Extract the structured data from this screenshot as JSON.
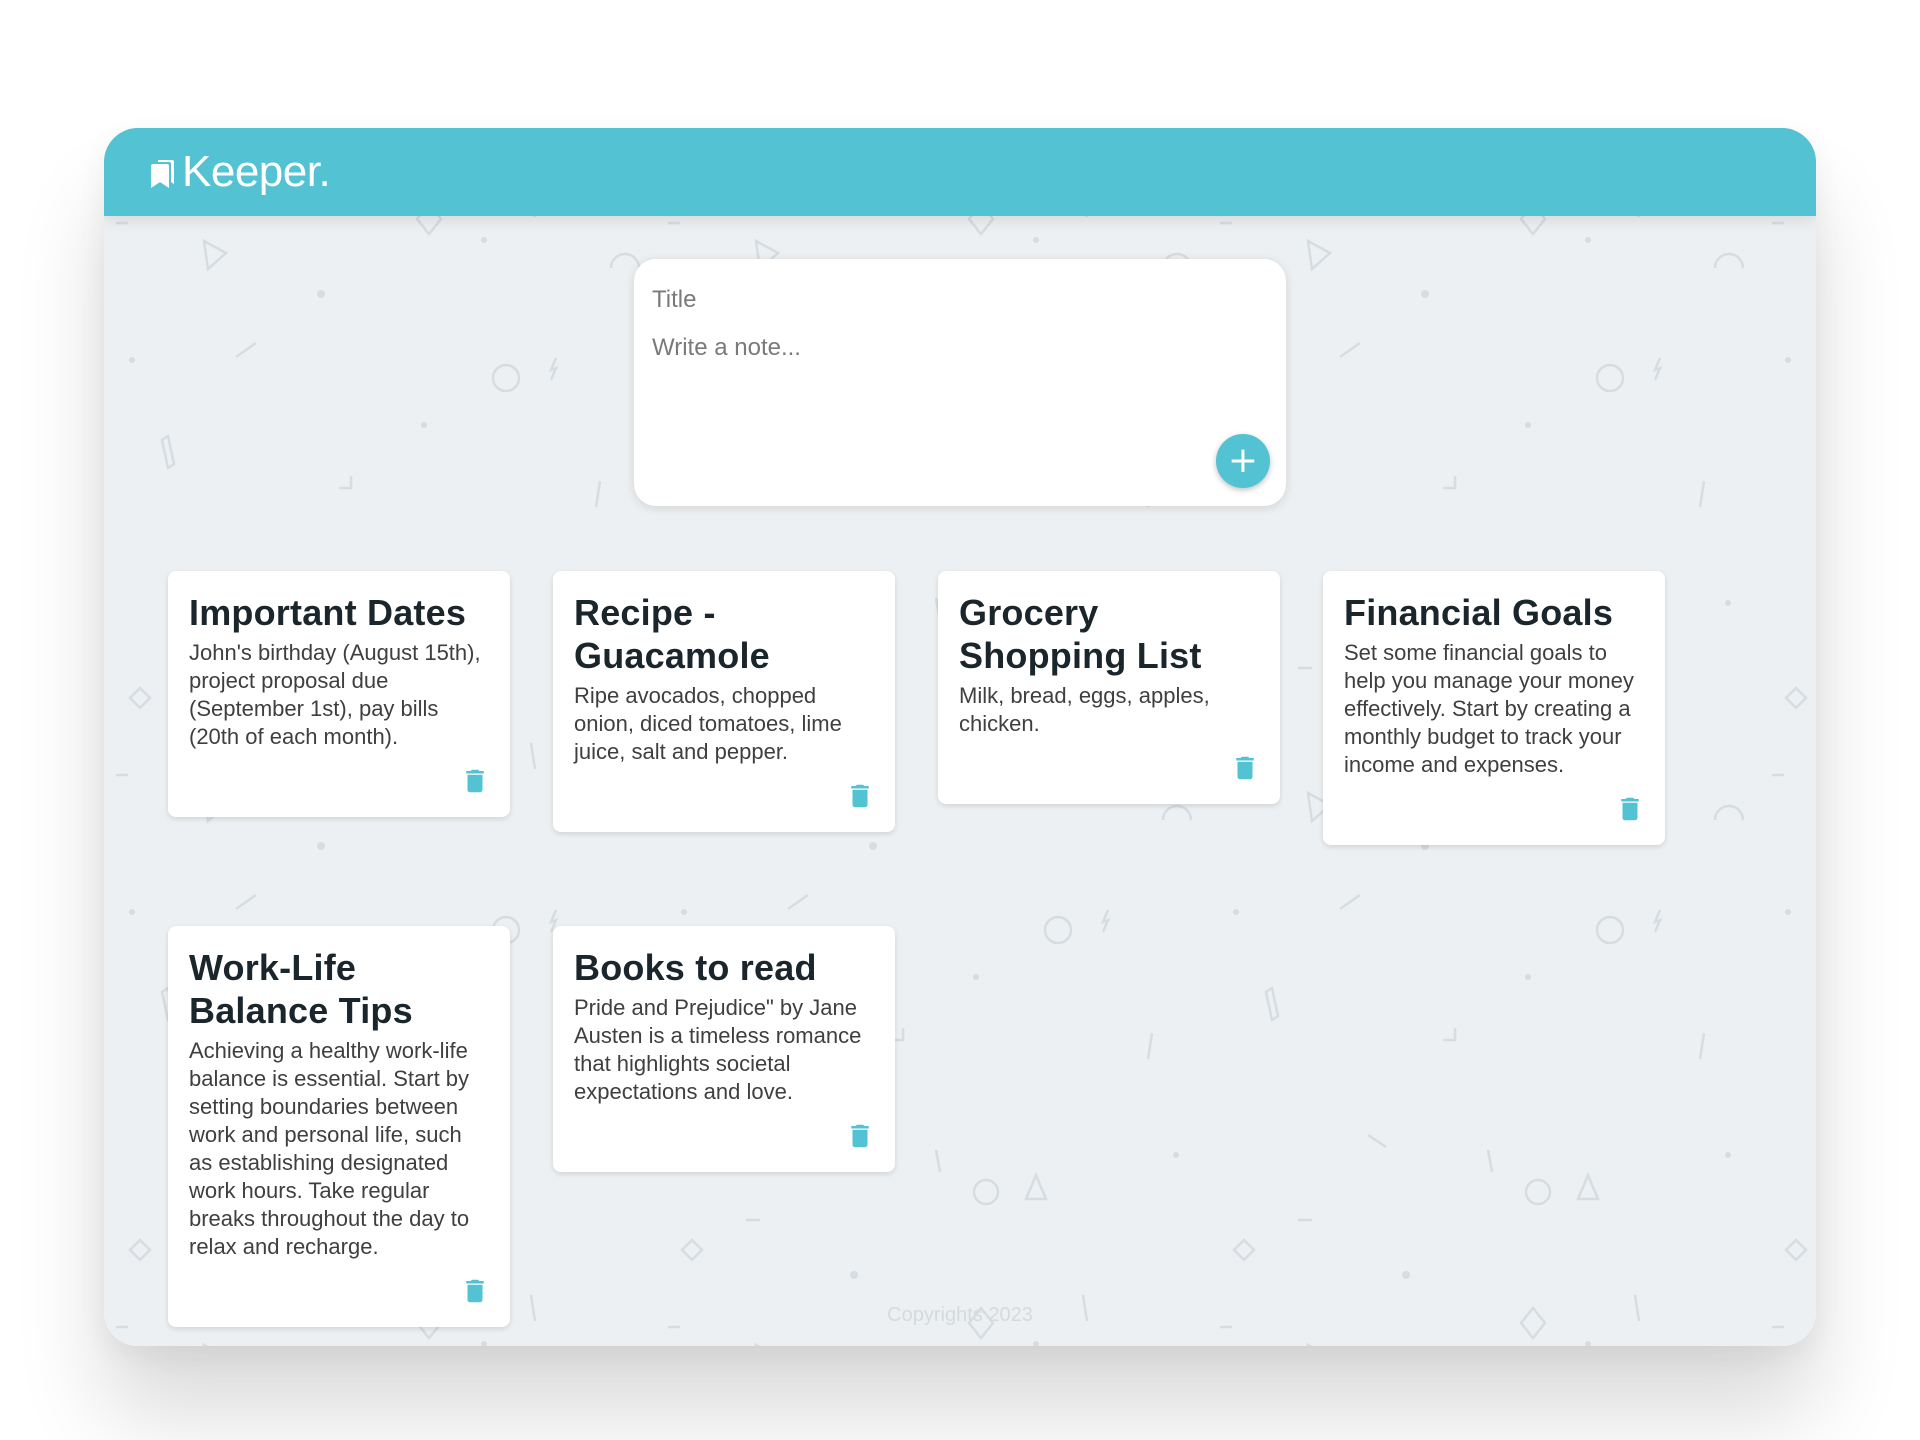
{
  "app": {
    "title": "Keeper.",
    "accent_color": "#53c3d3",
    "background_color": "#edf0f2"
  },
  "create_note": {
    "title_placeholder": "Title",
    "content_placeholder": "Write a note...",
    "title_value": "",
    "content_value": "",
    "add_label": "+",
    "add_icon": "plus-icon"
  },
  "notes": [
    {
      "title": "Important Dates",
      "content": "John's birthday (August 15th), project proposal due (September 1st), pay bills (20th of each month).",
      "delete_icon": "trash-icon"
    },
    {
      "title": "Recipe - Guacamole",
      "content": "Ripe avocados, chopped onion, diced tomatoes, lime juice, salt and pepper.",
      "delete_icon": "trash-icon"
    },
    {
      "title": "Grocery Shopping List",
      "content": "Milk, bread, eggs, apples, chicken.",
      "delete_icon": "trash-icon"
    },
    {
      "title": "Financial Goals",
      "content": "Set some financial goals to help you manage your money effectively. Start by creating a monthly budget to track your income and expenses.",
      "delete_icon": "trash-icon"
    },
    {
      "title": "Work-Life Balance Tips",
      "content": "Achieving a healthy work-life balance is essential. Start by setting boundaries between work and personal life, such as establishing designated work hours. Take regular breaks throughout the day to relax and recharge.",
      "delete_icon": "trash-icon"
    },
    {
      "title": "Books to read",
      "content": "Pride and Prejudice\" by Jane Austen is a timeless romance that highlights societal expectations and love.",
      "delete_icon": "trash-icon"
    }
  ],
  "footer": {
    "text": "Copyrights 2023"
  }
}
